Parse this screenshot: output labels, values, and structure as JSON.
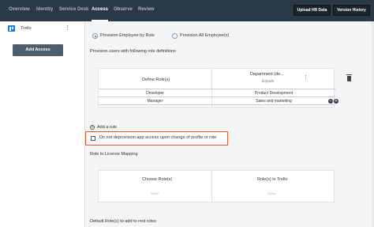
{
  "header": {
    "tabs": [
      {
        "label": "Overview",
        "active": false
      },
      {
        "label": "Identity",
        "active": false
      },
      {
        "label": "Service Desk",
        "active": false
      },
      {
        "label": "Access",
        "active": true
      },
      {
        "label": "Observe",
        "active": false
      },
      {
        "label": "Review",
        "active": false
      }
    ],
    "upload_label": "Upload HR Data",
    "version_label": "Version History"
  },
  "sidebar": {
    "app_name": "Trello",
    "add_access_label": "Add Access"
  },
  "main": {
    "provision_options": [
      {
        "label": "Provision Employee by Role",
        "selected": true
      },
      {
        "label": "Provision All Employee(s)",
        "selected": false
      }
    ],
    "rules_title": "Provision users with following role definitions",
    "rule_table": {
      "col1_header": "Define Role(s)",
      "col2_header": "Department (de...",
      "col2_operator": "Equals",
      "rows": [
        {
          "role": "Developer",
          "department": "Product Development"
        },
        {
          "role": "Manager",
          "department": "Sales and marketing"
        }
      ]
    },
    "add_rule_label": "Add a rule",
    "deprovision_label": "Do not deprovision app access upon change of profile or role",
    "license_title": "Role to License Mapping",
    "license_table": {
      "col1_header": "Choose Role(s)",
      "col2_header": "Role(s) in Trello",
      "placeholder1": "value",
      "placeholder2": "value"
    },
    "default_roles_title": "Default Role(s) to add to rest roles"
  },
  "colors": {
    "topbar": "#2a3946",
    "highlight_border": "#e05a2b",
    "radio_selected": "#2f74c0"
  }
}
